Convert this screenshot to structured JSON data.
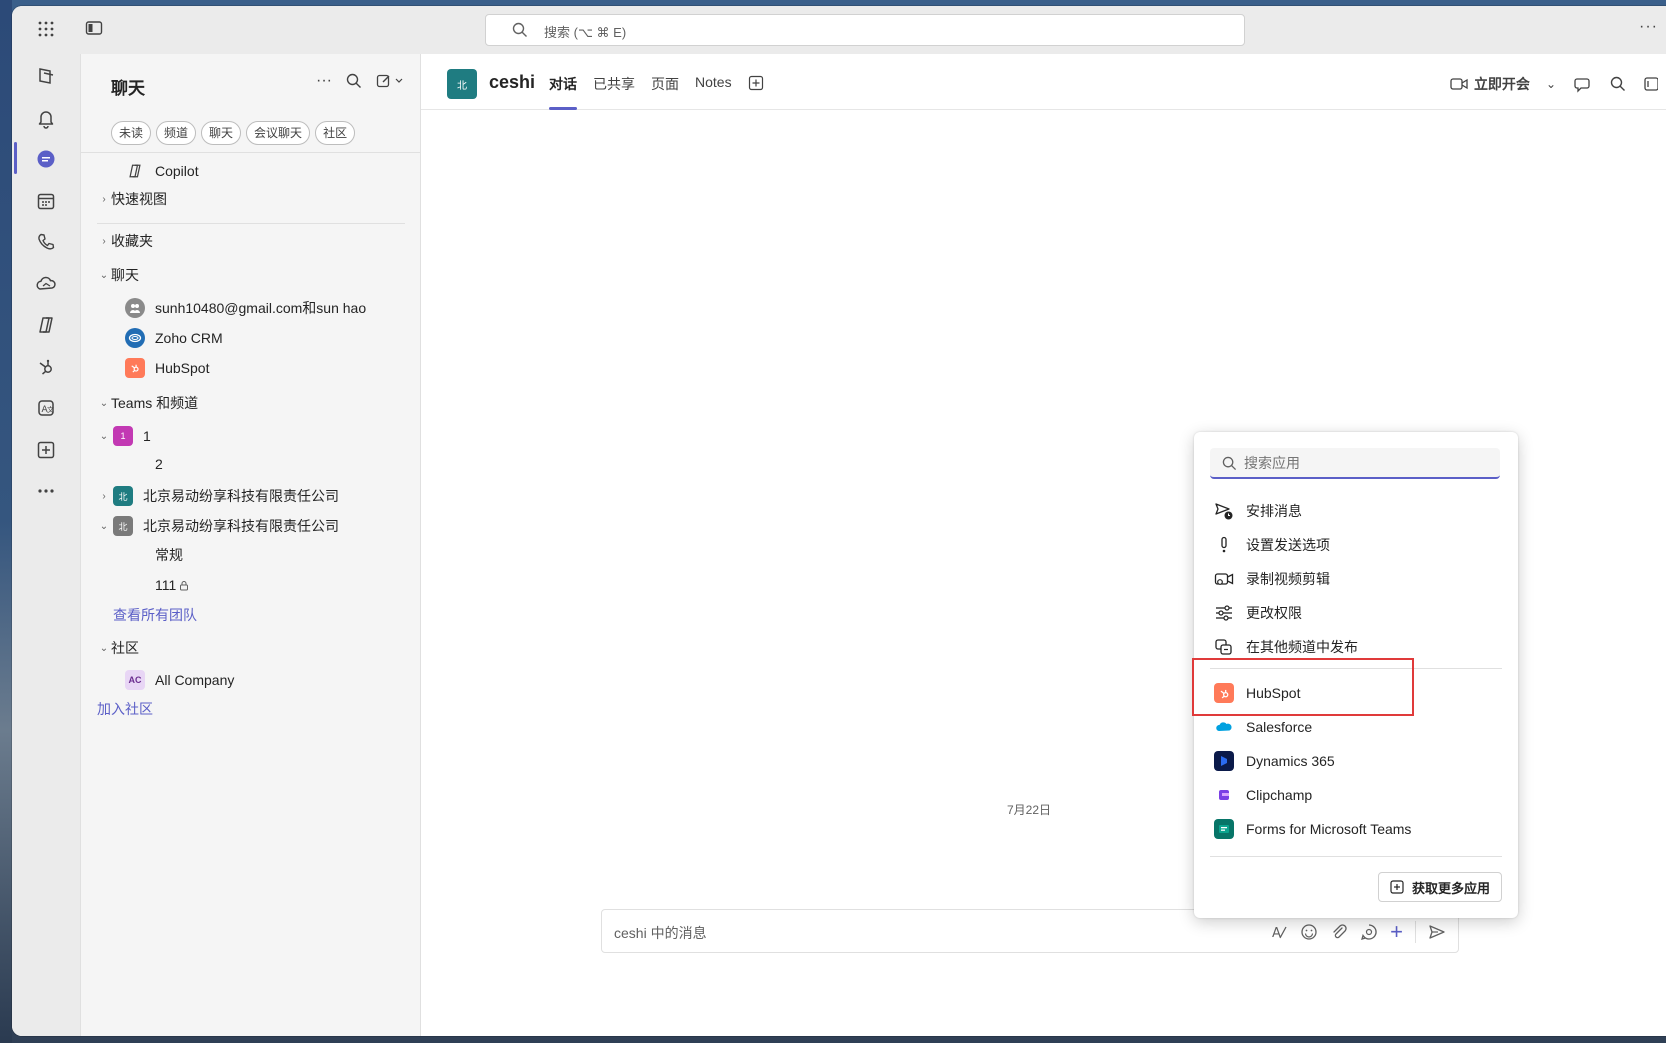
{
  "titlebar": {
    "search_placeholder": "搜索 (⌥ ⌘ E)"
  },
  "rail": {
    "items": [
      "activity",
      "notifications",
      "chat",
      "calendar",
      "calls",
      "onedrive",
      "copilot",
      "hubspot",
      "zoho",
      "add-apps",
      "more"
    ],
    "active": "chat"
  },
  "panel": {
    "title": "聊天",
    "filters": [
      "未读",
      "频道",
      "聊天",
      "会议聊天",
      "社区"
    ],
    "copilot": "Copilot",
    "quick_views": "快速视图",
    "favorites": "收藏夹",
    "chats_header": "聊天",
    "chats": [
      {
        "name": "sunh10480@gmail.com和sun hao",
        "avatar_color": "#8a8a8a"
      },
      {
        "name": "Zoho CRM",
        "avatar_color": "#226db4"
      },
      {
        "name": "HubSpot",
        "avatar_color": "#ff7a59"
      }
    ],
    "teams_header": "Teams 和频道",
    "teams": [
      {
        "name": "1",
        "avatar_color": "#c239b3",
        "avatar_text": "1",
        "channels": [
          "2"
        ]
      },
      {
        "name": "北京易动纷享科技有限责任公司",
        "avatar_color": "#1f7c81",
        "avatar_text": "北"
      },
      {
        "name": "北京易动纷享科技有限责任公司",
        "avatar_color": "#7a7a7a",
        "avatar_text": "北",
        "channels": [
          "常规",
          "111"
        ]
      }
    ],
    "see_all_teams": "查看所有团队",
    "community_header": "社区",
    "communities": [
      {
        "name": "All Company",
        "avatar_text": "AC",
        "avatar_color": "#e8d6f5"
      }
    ],
    "join_community": "加入社区"
  },
  "main": {
    "channel_avatar": "北",
    "channel_name": "ceshi",
    "tabs": [
      "对话",
      "已共享",
      "页面",
      "Notes"
    ],
    "active_tab": "对话",
    "meet_now": "立即开会",
    "date_separator": "7月22日",
    "composer_placeholder": "ceshi 中的消息"
  },
  "popup": {
    "search_placeholder": "搜索应用",
    "actions": [
      "安排消息",
      "设置发送选项",
      "录制视频剪辑",
      "更改权限",
      "在其他频道中发布"
    ],
    "apps": [
      {
        "name": "HubSpot",
        "color": "#ff7a59"
      },
      {
        "name": "Salesforce",
        "color": "#00a1e0"
      },
      {
        "name": "Dynamics 365",
        "color": "#0b1a4a"
      },
      {
        "name": "Clipchamp",
        "color": "#7b3fe4"
      },
      {
        "name": "Forms for Microsoft Teams",
        "color": "#077568"
      }
    ],
    "get_more": "获取更多应用"
  },
  "colors": {
    "accent": "#5b5fc7",
    "highlight": "#e03a3a"
  }
}
